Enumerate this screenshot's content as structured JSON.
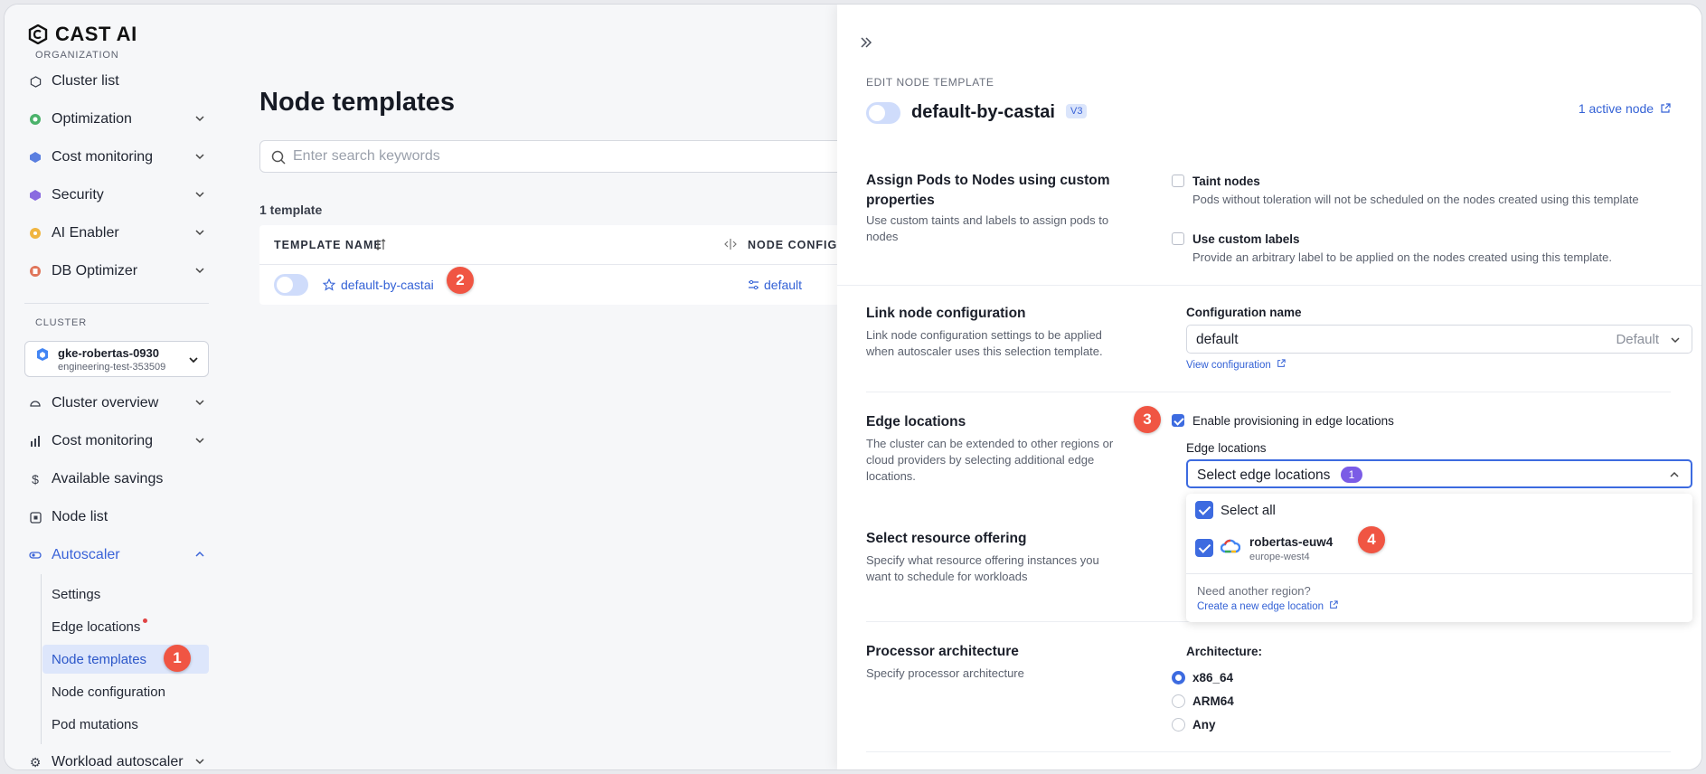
{
  "brand": {
    "name": "CAST AI"
  },
  "sidebar": {
    "org_label": "ORGANIZATION",
    "org_items": [
      {
        "label": "Cluster list",
        "icon": "hexagon-icon"
      },
      {
        "label": "Optimization",
        "icon": "optimization-icon"
      },
      {
        "label": "Cost monitoring",
        "icon": "cost-icon"
      },
      {
        "label": "Security",
        "icon": "security-icon"
      },
      {
        "label": "AI Enabler",
        "icon": "ai-icon"
      },
      {
        "label": "DB Optimizer",
        "icon": "db-icon"
      }
    ],
    "cluster_label": "CLUSTER",
    "cluster": {
      "name": "gke-robertas-0930",
      "project": "engineering-test-353509"
    },
    "cluster_items": [
      {
        "label": "Cluster overview"
      },
      {
        "label": "Cost monitoring"
      },
      {
        "label": "Available savings"
      },
      {
        "label": "Node list"
      },
      {
        "label": "Autoscaler"
      }
    ],
    "autoscaler_items": [
      {
        "label": "Settings"
      },
      {
        "label": "Edge locations"
      },
      {
        "label": "Node templates"
      },
      {
        "label": "Node configuration"
      },
      {
        "label": "Pod mutations"
      }
    ],
    "workload_autoscaler": "Workload autoscaler"
  },
  "main": {
    "title": "Node templates",
    "search_placeholder": "Enter search keywords",
    "count": "1 template",
    "col_template": "TEMPLATE NAME",
    "col_config": "NODE CONFIGU",
    "row": {
      "name": "default-by-castai",
      "config": "default"
    }
  },
  "drawer": {
    "edit_label": "EDIT NODE TEMPLATE",
    "template_name": "default-by-castai",
    "version": "V3",
    "active_nodes": "1 active node",
    "assign": {
      "title": "Assign Pods to Nodes using custom properties",
      "desc": "Use custom taints and labels to assign pods to nodes",
      "taint_title": "Taint nodes",
      "taint_desc": "Pods without toleration will not be scheduled on the nodes created using this template",
      "labels_title": "Use custom labels",
      "labels_desc": "Provide an arbitrary label to be applied on the nodes created using this template."
    },
    "link_config": {
      "title": "Link node configuration",
      "desc": "Link node configuration settings to be applied when autoscaler uses this selection template.",
      "field_label": "Configuration name",
      "value": "default",
      "value_tag": "Default",
      "view_link": "View configuration"
    },
    "edge": {
      "title": "Edge locations",
      "desc": "The cluster can be extended to other regions or cloud providers by selecting additional edge locations.",
      "enable_label": "Enable provisioning in edge locations",
      "field_label": "Edge locations",
      "select_label": "Select edge locations",
      "selected_count": "1",
      "select_all": "Select all",
      "location_name": "robertas-euw4",
      "location_region": "europe-west4",
      "need_region": "Need another region?",
      "create_link": "Create a new edge location"
    },
    "resource": {
      "title": "Select resource offering",
      "desc": "Specify what resource offering instances you want to schedule for workloads"
    },
    "processor": {
      "title": "Processor architecture",
      "desc": "Specify processor architecture",
      "field_label": "Architecture:",
      "options": [
        "x86_64",
        "ARM64",
        "Any"
      ],
      "selected": "x86_64"
    }
  },
  "annotations": [
    "1",
    "2",
    "3",
    "4"
  ],
  "colors": {
    "accent": "#3d6be0",
    "badge": "#f05543",
    "purple": "#7b5ce6"
  }
}
